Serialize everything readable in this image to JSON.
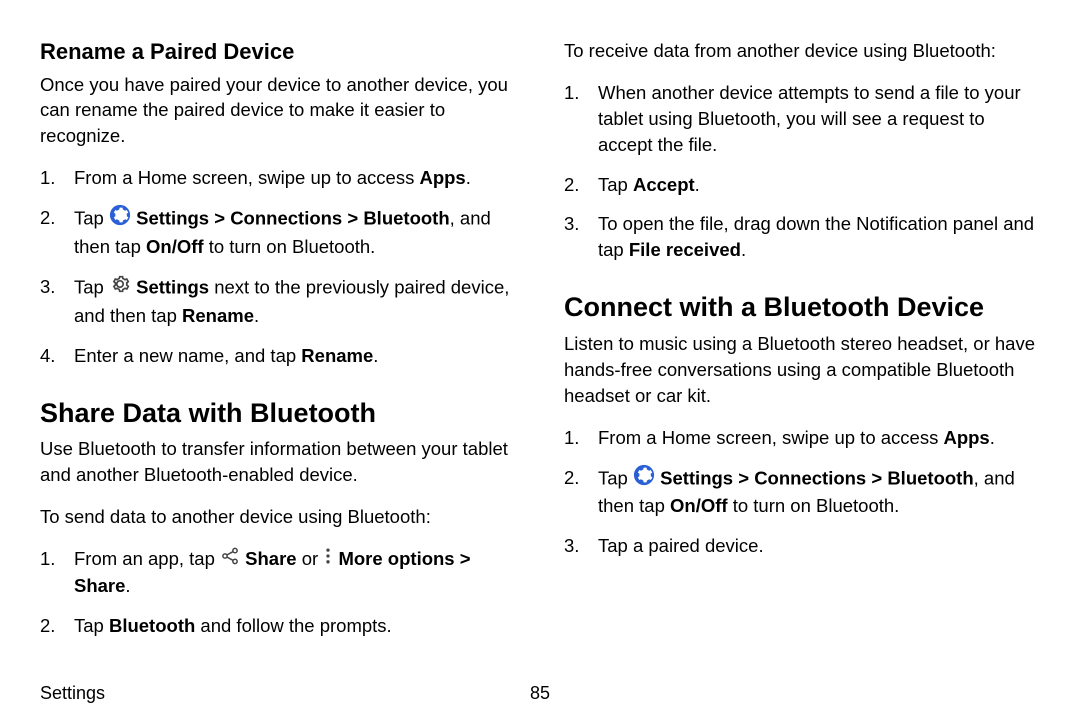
{
  "left": {
    "h_rename": "Rename a Paired Device",
    "p_rename": "Once you have paired your device to another device, you can rename the paired device to make it easier to recognize.",
    "rename_steps": {
      "s1_a": "From a Home screen, swipe up to access ",
      "s1_b": "Apps",
      "s1_c": ".",
      "s2_a": "Tap ",
      "s2_b": "Settings",
      "s2_c": " > ",
      "s2_d": "Connections",
      "s2_e": " > ",
      "s2_f": "Bluetooth",
      "s2_g": ", and then tap ",
      "s2_h": "On/Off",
      "s2_i": " to turn on Bluetooth.",
      "s3_a": "Tap ",
      "s3_b": "Settings",
      "s3_c": " next to the previously paired device, and then tap ",
      "s3_d": "Rename",
      "s3_e": ".",
      "s4_a": "Enter a new name, and tap ",
      "s4_b": "Rename",
      "s4_c": "."
    },
    "h_share": "Share Data with Bluetooth",
    "p_share": "Use Bluetooth to transfer information between your tablet and another Bluetooth-enabled device.",
    "p_send": "To send data to another device using Bluetooth:",
    "send_steps": {
      "s1_a": "From an app, tap ",
      "s1_b": "Share",
      "s1_c": " or ",
      "s1_d": "More options",
      "s1_e": " > ",
      "s1_f": "Share",
      "s1_g": ".",
      "s2_a": "Tap ",
      "s2_b": "Bluetooth",
      "s2_c": " and follow the prompts."
    }
  },
  "right": {
    "p_recv": "To receive data from another device using Bluetooth:",
    "recv_steps": {
      "s1": "When another device attempts to send a file to your tablet using Bluetooth, you will see a request to accept the file.",
      "s2_a": "Tap ",
      "s2_b": "Accept",
      "s2_c": ".",
      "s3_a": "To open the file, drag down the Notification panel and tap ",
      "s3_b": "File received",
      "s3_c": "."
    },
    "h_connect": "Connect with a Bluetooth Device",
    "p_connect": "Listen to music using a Bluetooth stereo headset, or have hands-free conversations using a compatible Bluetooth headset or car kit.",
    "connect_steps": {
      "s1_a": "From a Home screen, swipe up to access ",
      "s1_b": "Apps",
      "s1_c": ".",
      "s2_a": "Tap ",
      "s2_b": "Settings",
      "s2_c": " > ",
      "s2_d": "Connections",
      "s2_e": " > ",
      "s2_f": "Bluetooth",
      "s2_g": ", and then tap ",
      "s2_h": "On/Off",
      "s2_i": " to turn on Bluetooth.",
      "s3": "Tap a paired device."
    }
  },
  "footer": {
    "label": "Settings",
    "page": "85"
  },
  "icons": {
    "gear_blue_color": "#2a5fd6",
    "gear_outline_color": "#444"
  }
}
